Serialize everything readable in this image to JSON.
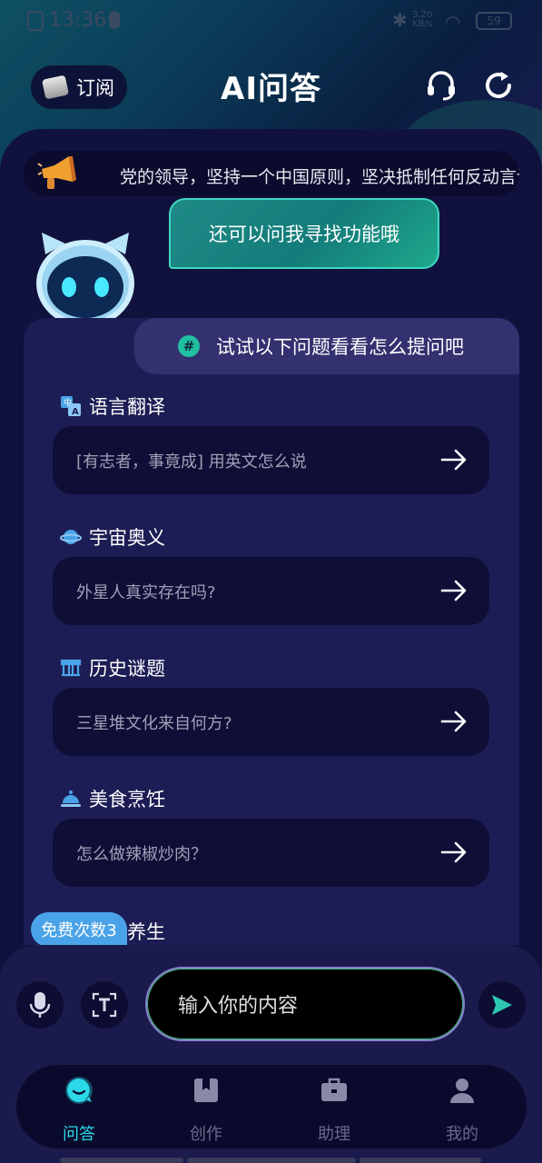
{
  "status_bar": {
    "time": "13:36",
    "net_speed_value": "3.20",
    "net_speed_unit": "KB/s",
    "battery": "59"
  },
  "header": {
    "subscribe_label": "订阅",
    "title": "AI问答",
    "support_icon": "headset-icon",
    "refresh_icon": "refresh-icon"
  },
  "marquee": {
    "text": "党的领导，坚持一个中国原则，坚决抵制任何反动言论"
  },
  "assistant": {
    "bubble_text": "还可以问我寻找功能哦"
  },
  "suggestions": {
    "tab_label": "试试以下问题看看怎么提问吧",
    "tab_icon": "#",
    "categories": [
      {
        "title": "语言翻译",
        "icon": "translate-icon",
        "question": "[有志者，事竟成] 用英文怎么说"
      },
      {
        "title": "宇宙奥义",
        "icon": "planet-icon",
        "question": "外星人真实存在吗?"
      },
      {
        "title": "历史谜题",
        "icon": "history-icon",
        "question": "三星堆文化来自何方?"
      },
      {
        "title": "美食烹饪",
        "icon": "cloche-icon",
        "question": "怎么做辣椒炒肉？"
      }
    ],
    "partial_category": "养生"
  },
  "free_badge": "免费次数3",
  "composer": {
    "placeholder": "输入你的内容"
  },
  "nav": [
    {
      "label": "问答",
      "icon": "chat-icon",
      "active": true
    },
    {
      "label": "创作",
      "icon": "bookmark-icon",
      "active": false
    },
    {
      "label": "助理",
      "icon": "briefcase-icon",
      "active": false
    },
    {
      "label": "我的",
      "icon": "user-icon",
      "active": false
    }
  ],
  "colors": {
    "accent": "#2ad8e8",
    "bubble": "#1e8a86",
    "card": "#1d1d55",
    "background": "#11113d"
  }
}
